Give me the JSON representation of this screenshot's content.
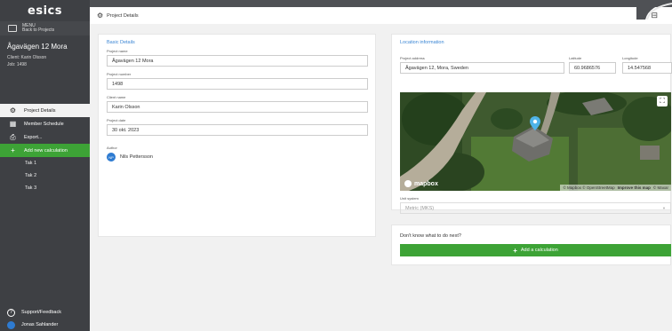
{
  "app": {
    "logo": "esics"
  },
  "sidebar": {
    "back_line1": "MENU",
    "back_line2": "Back to Projects",
    "project_title": "Ågavägen 12 Mora",
    "client_line": "Client: Karin Olsson",
    "job_line": "Job: 1498",
    "nav": [
      {
        "label": "Project Details",
        "icon": "gear-icon"
      },
      {
        "label": "Member Schedule",
        "icon": "grid-icon"
      },
      {
        "label": "Export...",
        "icon": "printer-icon"
      },
      {
        "label": "Add new calculation",
        "icon": "plus-icon"
      }
    ],
    "calculations": [
      "Tak 1",
      "Tak 2",
      "Tak 3"
    ],
    "support_label": "Support/Feedback",
    "user_name": "Jonas Sahlander"
  },
  "topbar": {
    "title": "Project Details"
  },
  "basic": {
    "title": "Basic Details",
    "project_name_label": "Project name",
    "project_name": "Ågavägen 12 Mora",
    "project_number_label": "Project number",
    "project_number": "1498",
    "client_name_label": "Client name",
    "client_name": "Karin Olsson",
    "project_date_label": "Project date",
    "project_date": "30 okt. 2023",
    "author_label": "Author",
    "author_initials": "NP",
    "author_name": "Nils Pettersson"
  },
  "location": {
    "title": "Location information",
    "address_label": "Project address",
    "address": "Ågavägen 12, Mora, Sweden",
    "latitude_label": "Latitude",
    "latitude": "60.9686576",
    "longitude_label": "Longitude",
    "longitude": "14.547568",
    "map_brand": "mapbox",
    "map_attribution": "© Mapbox © OpenStreetMap",
    "map_improve": "Improve this map",
    "map_maxar": "© Maxar",
    "unit_label": "Unit system",
    "unit_value": "Metric (MKS)"
  },
  "next": {
    "prompt": "Don't know what to do next?",
    "button": "Add a calculation"
  }
}
